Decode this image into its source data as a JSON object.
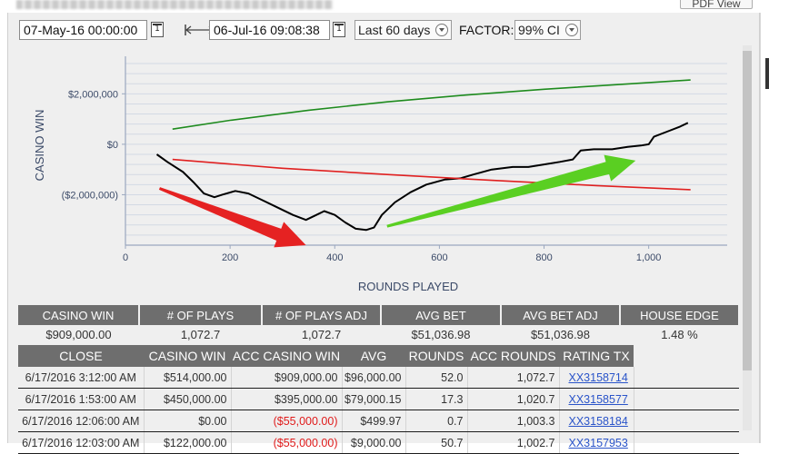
{
  "window": {
    "pdf_button_label": "PDF View"
  },
  "controls": {
    "start_date": "07-May-16 00:00:00",
    "end_date": "06-Jul-16 09:08:38",
    "calendar_icon": "calendar-icon",
    "calendar_glyph": "1",
    "range_preset": "Last 60 days",
    "factor_label": "FACTOR:",
    "factor_value": "99% CI"
  },
  "chart_data": {
    "type": "line",
    "xlabel": "ROUNDS PLAYED",
    "ylabel": "CASINO WIN",
    "xlim": [
      0,
      1150
    ],
    "ylim": [
      -4000000,
      3200000
    ],
    "x_ticks": [
      0,
      200,
      400,
      600,
      800,
      1000
    ],
    "x_tick_labels": [
      "0",
      "200",
      "400",
      "600",
      "800",
      "1,000"
    ],
    "y_ticks": [
      2000000,
      0,
      -2000000
    ],
    "y_tick_labels": [
      "$2,000,000",
      "$0",
      "($2,000,000)"
    ],
    "grid": "horizontal",
    "series": [
      {
        "color": "#000000",
        "points": [
          [
            60,
            -400000
          ],
          [
            80,
            -700000
          ],
          [
            110,
            -1100000
          ],
          [
            130,
            -1500000
          ],
          [
            150,
            -1950000
          ],
          [
            170,
            -2100000
          ],
          [
            185,
            -2000000
          ],
          [
            210,
            -1850000
          ],
          [
            235,
            -1950000
          ],
          [
            260,
            -2200000
          ],
          [
            290,
            -2500000
          ],
          [
            320,
            -2800000
          ],
          [
            345,
            -3000000
          ],
          [
            365,
            -2800000
          ],
          [
            380,
            -2650000
          ],
          [
            400,
            -2800000
          ],
          [
            420,
            -3100000
          ],
          [
            440,
            -3350000
          ],
          [
            460,
            -3400000
          ],
          [
            475,
            -3300000
          ],
          [
            490,
            -2800000
          ],
          [
            515,
            -2300000
          ],
          [
            545,
            -1900000
          ],
          [
            575,
            -1600000
          ],
          [
            610,
            -1400000
          ],
          [
            640,
            -1350000
          ],
          [
            665,
            -1200000
          ],
          [
            700,
            -1000000
          ],
          [
            740,
            -900000
          ],
          [
            770,
            -900000
          ],
          [
            800,
            -800000
          ],
          [
            830,
            -700000
          ],
          [
            855,
            -600000
          ],
          [
            870,
            -250000
          ],
          [
            895,
            -200000
          ],
          [
            930,
            -200000
          ],
          [
            960,
            -100000
          ],
          [
            985,
            -50000
          ],
          [
            1000,
            0
          ],
          [
            1010,
            300000
          ],
          [
            1035,
            500000
          ],
          [
            1060,
            700000
          ],
          [
            1075,
            850000
          ]
        ]
      },
      {
        "color": "#1e8b1e",
        "points": [
          [
            90,
            600000
          ],
          [
            200,
            950000
          ],
          [
            350,
            1350000
          ],
          [
            500,
            1680000
          ],
          [
            650,
            1950000
          ],
          [
            800,
            2180000
          ],
          [
            950,
            2380000
          ],
          [
            1080,
            2550000
          ]
        ]
      },
      {
        "color": "#e02020",
        "points": [
          [
            90,
            -600000
          ],
          [
            300,
            -950000
          ],
          [
            500,
            -1200000
          ],
          [
            700,
            -1430000
          ],
          [
            900,
            -1640000
          ],
          [
            1080,
            -1800000
          ]
        ]
      }
    ],
    "annotations": [
      {
        "type": "arrow",
        "color": "#e52222",
        "from": [
          65,
          -1750000
        ],
        "to": [
          345,
          -4000000
        ]
      },
      {
        "type": "arrow",
        "color": "#5acf22",
        "from": [
          500,
          -3250000
        ],
        "to": [
          975,
          -650000
        ]
      }
    ]
  },
  "summary": {
    "headers": [
      "CASINO WIN",
      "# OF PLAYS",
      "# OF PLAYS ADJ",
      "AVG BET",
      "AVG BET ADJ",
      "HOUSE EDGE"
    ],
    "values": [
      "$909,000.00",
      "1,072.7",
      "1,072.7",
      "$51,036.98",
      "$51,036.98",
      "1.48 %"
    ]
  },
  "detail": {
    "headers": [
      "CLOSE",
      "CASINO WIN",
      "ACC CASINO WIN",
      "AVG",
      "ROUNDS",
      "ACC ROUNDS",
      "RATING TX",
      ""
    ],
    "rows": [
      {
        "close": "6/17/2016 3:12:00 AM",
        "casino_win": "$514,000.00",
        "acc_casino_win": "$909,000.00",
        "avg": "$96,000.00",
        "rounds": "52.0",
        "acc_rounds": "1,072.7",
        "rating_tx": "XX3158714"
      },
      {
        "close": "6/17/2016 1:53:00 AM",
        "casino_win": "$450,000.00",
        "acc_casino_win": "$395,000.00",
        "avg": "$79,000.15",
        "rounds": "17.3",
        "acc_rounds": "1,020.7",
        "rating_tx": "XX3158577"
      },
      {
        "close": "6/17/2016 12:06:00 AM",
        "casino_win": "$0.00",
        "acc_casino_win": "($55,000.00)",
        "avg": "$499.97",
        "rounds": "0.7",
        "acc_rounds": "1,003.3",
        "rating_tx": "XX3158184"
      },
      {
        "close": "6/17/2016 12:03:00 AM",
        "casino_win": "$122,000.00",
        "acc_casino_win": "($55,000.00)",
        "avg": "$9,000.00",
        "rounds": "50.7",
        "acc_rounds": "1,002.7",
        "rating_tx": "XX3157953"
      }
    ]
  }
}
